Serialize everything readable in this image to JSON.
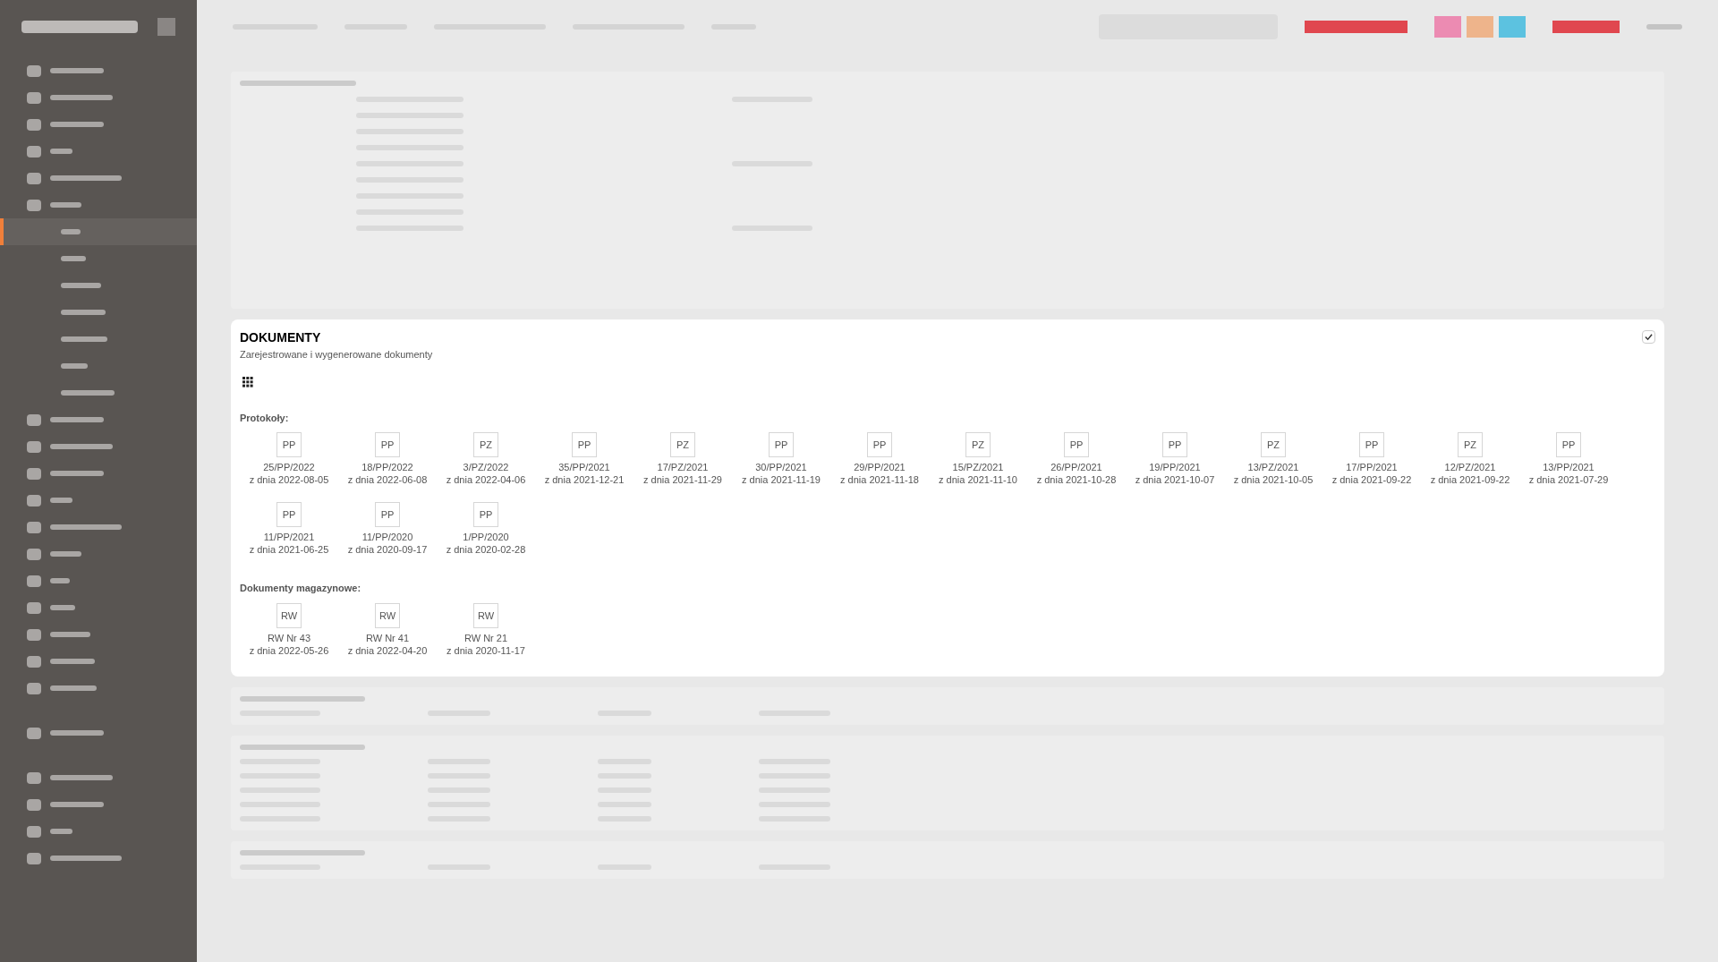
{
  "documents": {
    "title": "DOKUMENTY",
    "subtitle": "Zarejestrowane i wygenerowane dokumenty",
    "checked": true,
    "groups": [
      {
        "label": "Protokoły:",
        "items": [
          {
            "code": "PP",
            "number": "25/PP/2022",
            "date": "z dnia 2022-08-05"
          },
          {
            "code": "PP",
            "number": "18/PP/2022",
            "date": "z dnia 2022-06-08"
          },
          {
            "code": "PZ",
            "number": "3/PZ/2022",
            "date": "z dnia 2022-04-06"
          },
          {
            "code": "PP",
            "number": "35/PP/2021",
            "date": "z dnia 2021-12-21"
          },
          {
            "code": "PZ",
            "number": "17/PZ/2021",
            "date": "z dnia 2021-11-29"
          },
          {
            "code": "PP",
            "number": "30/PP/2021",
            "date": "z dnia 2021-11-19"
          },
          {
            "code": "PP",
            "number": "29/PP/2021",
            "date": "z dnia 2021-11-18"
          },
          {
            "code": "PZ",
            "number": "15/PZ/2021",
            "date": "z dnia 2021-11-10"
          },
          {
            "code": "PP",
            "number": "26/PP/2021",
            "date": "z dnia 2021-10-28"
          },
          {
            "code": "PP",
            "number": "19/PP/2021",
            "date": "z dnia 2021-10-07"
          },
          {
            "code": "PZ",
            "number": "13/PZ/2021",
            "date": "z dnia 2021-10-05"
          },
          {
            "code": "PP",
            "number": "17/PP/2021",
            "date": "z dnia 2021-09-22"
          },
          {
            "code": "PZ",
            "number": "12/PZ/2021",
            "date": "z dnia 2021-09-22"
          },
          {
            "code": "PP",
            "number": "13/PP/2021",
            "date": "z dnia 2021-07-29"
          },
          {
            "code": "PP",
            "number": "11/PP/2021",
            "date": "z dnia 2021-06-25"
          },
          {
            "code": "PP",
            "number": "11/PP/2020",
            "date": "z dnia 2020-09-17"
          },
          {
            "code": "PP",
            "number": "1/PP/2020",
            "date": "z dnia 2020-02-28"
          }
        ]
      },
      {
        "label": "Dokumenty magazynowe:",
        "items": [
          {
            "code": "RW",
            "number": "RW Nr 43",
            "date": "z dnia 2022-05-26"
          },
          {
            "code": "RW",
            "number": "RW Nr 41",
            "date": "z dnia 2022-04-20"
          },
          {
            "code": "RW",
            "number": "RW Nr 21",
            "date": "z dnia 2020-11-17"
          }
        ]
      }
    ]
  }
}
